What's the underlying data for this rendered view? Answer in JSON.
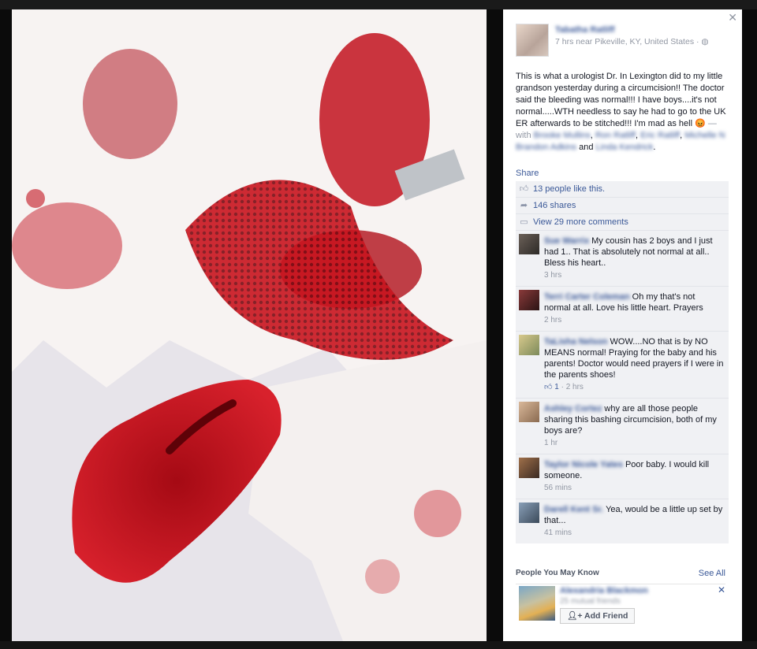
{
  "post": {
    "author": "Tabatha Ratliff",
    "meta": "7 hrs near Pikeville, KY, United States · ◍",
    "text_main": "This is what a urologist Dr. In Lexington did to my little grandson yesterday during a circumcision!! The doctor said the bleeding was normal!!! I have boys....it's not normal.....WTH needless to say he had to go to the UK ER afterwards to be stitched!!! I'm mad as hell",
    "emoji": "😡",
    "with_prefix": "— with",
    "tagged": [
      "Brooke Mullins",
      "Ron Ratliff",
      "Eric Ratliff",
      "Michelle N",
      "Brandon Adkins"
    ],
    "tagged_and": "and",
    "tagged_last": "Linda Kendrick",
    "tagged_end": "."
  },
  "actions": {
    "share": "Share"
  },
  "ufi": {
    "likes": "13 people like this.",
    "shares": "146 shares",
    "more_comments": "View 29 more comments"
  },
  "comments": [
    {
      "name": "Sue Warrix",
      "text": "My cousin has 2 boys and I just had 1.. That is absolutely not normal at all.. Bless his heart..",
      "time": "3 hrs",
      "likes": ""
    },
    {
      "name": "Terri Carter Coleman",
      "text": "Oh my that's not normal at all. Love his little heart. Prayers",
      "time": "2 hrs",
      "likes": ""
    },
    {
      "name": "TaLisha Nelson",
      "text": "WOW....NO that is by NO MEANS normal! Praying for the baby and his parents! Doctor would need prayers if I were in the parents shoes!",
      "time": "2 hrs",
      "likes": "1"
    },
    {
      "name": "Ashley Cortez",
      "text": "why are all those people sharing this bashing circumcision, both of my boys are?",
      "time": "1 hr",
      "likes": ""
    },
    {
      "name": "Taylor Nicole Yates",
      "text": "Poor baby. I would kill someone.",
      "time": "56 mins",
      "likes": ""
    },
    {
      "name": "Darell Kent Sr.",
      "text": "Yea, would be a little up set by that...",
      "time": "41 mins",
      "likes": ""
    }
  ],
  "pymk": {
    "title": "People You May Know",
    "see_all": "See All",
    "name": "Alexandria Blackmon",
    "mutual": "25 mutual friends",
    "add_friend": "Add Friend"
  },
  "colors": {
    "link": "#3b5998",
    "muted": "#9197a3",
    "ufi_bg": "#f0f1f4",
    "blood": "#c0101c"
  },
  "icons": {
    "like": "thumbs-up-icon",
    "share": "share-arrow-icon",
    "comment": "speech-bubble-icon",
    "close": "close-icon",
    "globe": "globe-icon"
  }
}
